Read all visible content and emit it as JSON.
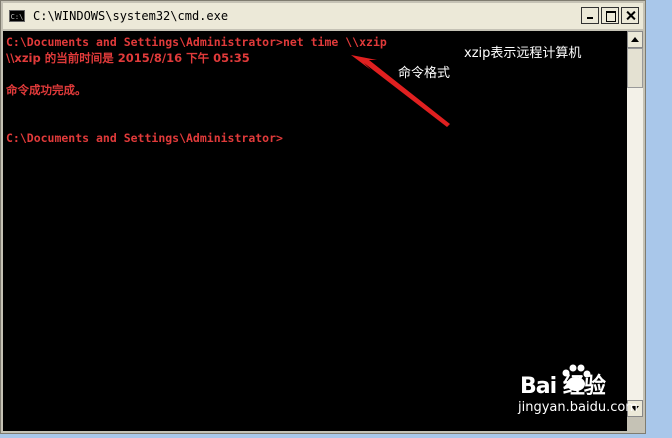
{
  "window": {
    "icon_text": "C:\\",
    "title": "C:\\WINDOWS\\system32\\cmd.exe"
  },
  "console": {
    "lines": [
      "C:\\Documents and Settings\\Administrator>net time \\\\xzip",
      "\\\\xzip 的当前时间是 2015/8/16 下午 05:35",
      "命令成功完成。",
      "C:\\Documents and Settings\\Administrator>"
    ]
  },
  "annotations": {
    "remote_computer": "xzip表示远程计算机",
    "command_format": "命令格式"
  },
  "watermark": {
    "logo": "Bai 经验",
    "url": "jingyan.baidu.com"
  },
  "colors": {
    "console_text": "#e03a3a",
    "console_bg": "#000000",
    "arrow": "#e02020"
  }
}
